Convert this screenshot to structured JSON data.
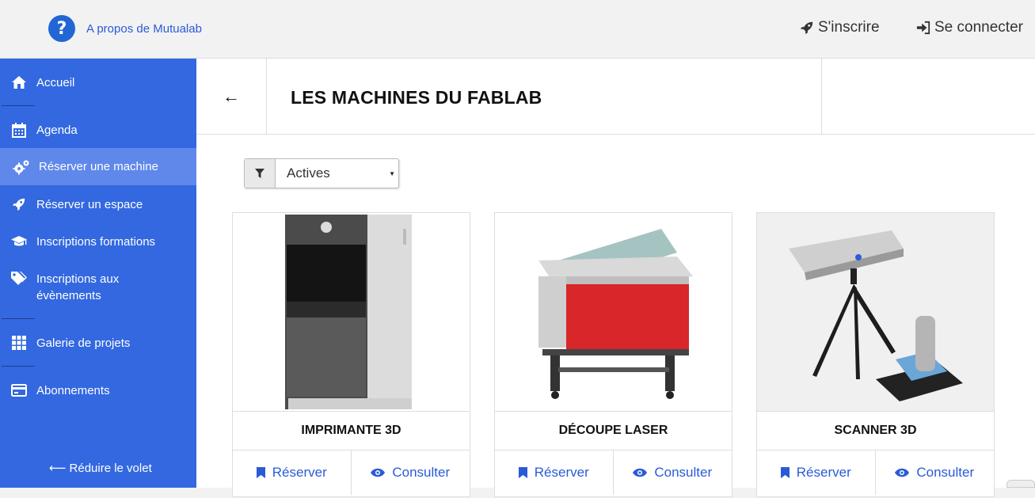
{
  "topbar": {
    "about_label": "A propos de Mutualab",
    "signup_label": "S'inscrire",
    "login_label": "Se connecter"
  },
  "sidebar": {
    "items": [
      {
        "label": "Accueil",
        "icon": "home-icon"
      },
      {
        "label": "Agenda",
        "icon": "calendar-icon"
      },
      {
        "label": "Réserver une machine",
        "icon": "gears-icon"
      },
      {
        "label": "Réserver un espace",
        "icon": "rocket-icon"
      },
      {
        "label": "Inscriptions formations",
        "icon": "graduation-cap-icon"
      },
      {
        "label": "Inscriptions aux évènements",
        "icon": "tags-icon"
      },
      {
        "label": "Galerie de projets",
        "icon": "grid-icon"
      },
      {
        "label": "Abonnements",
        "icon": "credit-card-icon"
      }
    ],
    "collapse_label": "Réduire le volet"
  },
  "header": {
    "title": "LES MACHINES DU FABLAB",
    "back_glyph": "←"
  },
  "filter": {
    "selected": "Actives"
  },
  "machines": [
    {
      "name": "IMPRIMANTE 3D",
      "reserve_label": "Réserver",
      "view_label": "Consulter"
    },
    {
      "name": "DÉCOUPE LASER",
      "reserve_label": "Réserver",
      "view_label": "Consulter"
    },
    {
      "name": "SCANNER 3D",
      "reserve_label": "Réserver",
      "view_label": "Consulter"
    }
  ],
  "colors": {
    "sidebar": "#3368e0",
    "sidebar_active": "#5f88ea",
    "link": "#2a5bd7"
  }
}
